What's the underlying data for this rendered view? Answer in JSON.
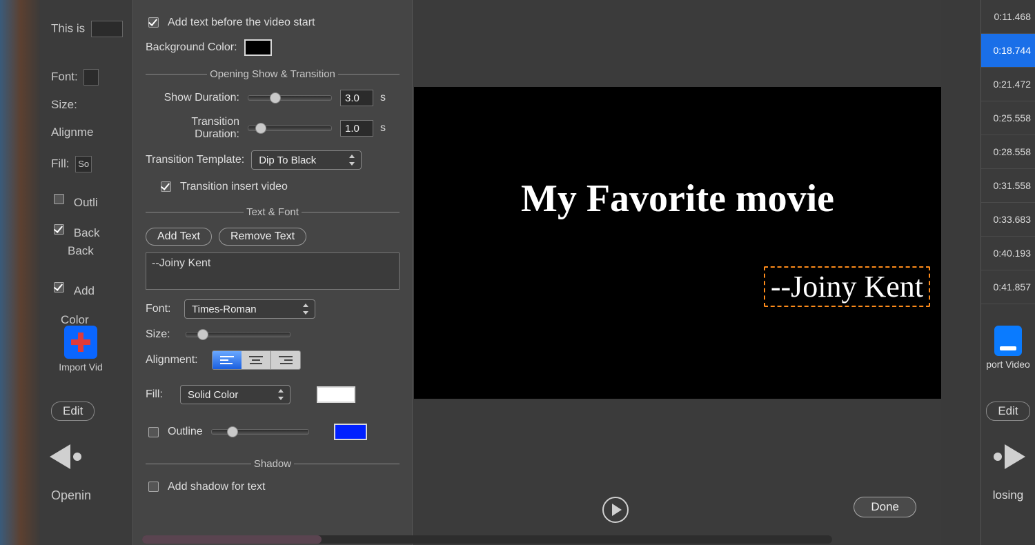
{
  "underlying": {
    "text_preview": "This is",
    "font_label": "Font:",
    "size_label": "Size:",
    "alignment_label": "Alignme",
    "fill_label": "Fill:",
    "fill_value_fragment": "So",
    "outline_label": "Outli",
    "back_label_1": "Back",
    "back_label_2": "Back",
    "add_label": "Add",
    "color_label": "Color",
    "import_video_label": "Import Vid",
    "edit_button": "Edit",
    "opening_label": "Openin"
  },
  "popover": {
    "add_text_before_start": "Add text before the video start",
    "add_text_before_start_checked": true,
    "background_color_label": "Background Color:",
    "background_color": "#000000",
    "section_opening": "Opening Show & Transition",
    "show_duration_label": "Show Duration:",
    "show_duration_value": "3.0",
    "duration_unit": "s",
    "transition_duration_label": "Transition Duration:",
    "transition_duration_value": "1.0",
    "transition_template_label": "Transition Template:",
    "transition_template_value": "Dip To Black",
    "transition_insert_video": "Transition insert video",
    "transition_insert_video_checked": true,
    "section_textfont": "Text & Font",
    "add_text_btn": "Add Text",
    "remove_text_btn": "Remove Text",
    "text_value": "--Joiny Kent",
    "font_label": "Font:",
    "font_value": "Times-Roman",
    "size_label": "Size:",
    "alignment_label": "Alignment:",
    "fill_label": "Fill:",
    "fill_value": "Solid Color",
    "fill_color": "#ffffff",
    "outline_label": "Outline",
    "outline_checked": false,
    "outline_color": "#0020ff",
    "section_shadow": "Shadow",
    "add_shadow_label": "Add shadow for text",
    "add_shadow_checked": false
  },
  "preview": {
    "title_text": "My Favorite movie",
    "author_text": "--Joiny Kent"
  },
  "footer": {
    "done_label": "Done"
  },
  "right": {
    "timestamps": [
      "0:11.468",
      "0:18.744",
      "0:21.472",
      "0:25.558",
      "0:28.558",
      "0:31.558",
      "0:33.683",
      "0:40.193",
      "0:41.857"
    ],
    "active_index": 1,
    "export_label": "port Video",
    "edit_label": "Edit",
    "closing_label": "losing"
  }
}
